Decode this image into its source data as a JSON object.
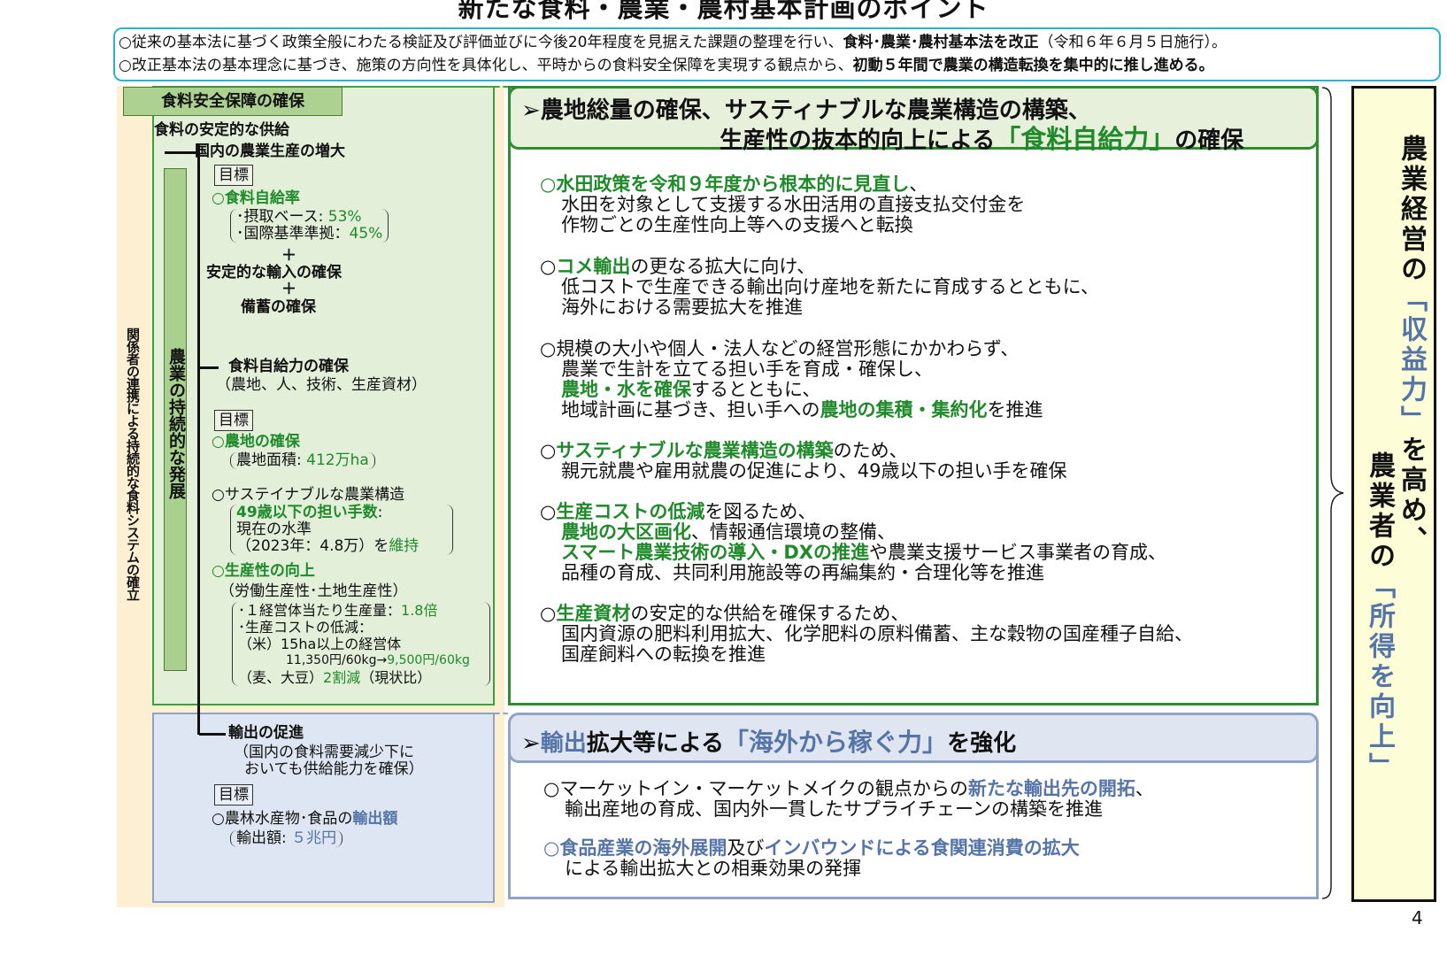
{
  "title": "新たな食料・農業・農村基本計画のポイント",
  "intro": {
    "line1_pre": "○従来の基本法に基づく政策全般にわたる検証及び評価並びに今後20年程度を見据えた課題の整理を行い、",
    "line1_bold": "食料･農業･農村基本法を改正",
    "line1_post": "（令和６年６月５日施行）。",
    "line2_pre": "○改正基本法の基本理念に基づき、施策の方向性を具体化し、平時からの食料安全保障を実現する観点から、",
    "line2_bold": "初動５年間で農業の構造転換を集中的に推し進める。"
  },
  "left": {
    "tag": "食料安全保障の確保",
    "vertical_outer": "関係者の連携による持続的な食料システムの確立",
    "vertical_stem": "農業の持続的な発展",
    "supply": "食料の安定的な供給",
    "domestic": "国内の農業生産の増大",
    "goal_label": "目標",
    "self_sufficiency": "○食料自給率",
    "ss_cal_label": "･摂取ベース: ",
    "ss_cal_value": "53%",
    "ss_intl_label": "･国際基準準拠：",
    "ss_intl_value": "45%",
    "plus": "＋",
    "import": "安定的な輸入の確保",
    "stock": "備蓄の確保",
    "capacity": "食料自給力の確保",
    "capacity_sub": "（農地、人、技術、生産資材）",
    "farmland": "○農地の確保",
    "farmland_area_label": "農地面積: ",
    "farmland_area_value": "412万ha",
    "sustainable": "○サステイナブルな農業構造",
    "young_label": "49歳以下の担い手数",
    "young_colon": ":",
    "young_line2": "現在の水準",
    "young_line3": "（2023年：4.8万）を",
    "young_keep": "維持",
    "productivity": "○生産性の向上",
    "productivity_sub": "（労働生産性･土地生産性）",
    "prod_line1_label": "･１経営体当たり生産量：",
    "prod_line1_value": "1.8倍",
    "prod_line2": "･生産コストの低減：",
    "prod_line3": "（米）15ha以上の経営体",
    "prod_line4_pre": "11,350円/60kg→",
    "prod_line4_value": "9,500円/60kg",
    "prod_line5_pre": "（麦、大豆）",
    "prod_line5_value": "2割減",
    "prod_line5_post": "（現状比）",
    "export": "輸出の促進",
    "export_sub1": "（国内の食料需要減少下に",
    "export_sub2": "おいても供給能力を確保）",
    "export_goal_pre": "○農林水産物･食品の",
    "export_goal_kw": "輸出額",
    "export_amount_label": "輸出額: ",
    "export_amount_value": "５兆円"
  },
  "right_green": {
    "heading1": "➢農地総量の確保、サスティナブルな農業構造の構築、",
    "heading2_pre": "生産性の抜本的向上による",
    "heading2_kw": "「食料自給力」",
    "heading2_post": "の確保",
    "items": [
      {
        "kw": "○水田政策を令和９年度から根本的に見直し",
        "rest": "、",
        "l2": "水田を対象として支援する水田活用の直接支払交付金を",
        "l3": "作物ごとの生産性向上等への支援へと転換"
      },
      {
        "pre": "○",
        "kw": "コメ輸出",
        "rest": "の更なる拡大に向け、",
        "l2": "低コストで生産できる輸出向け産地を新たに育成するとともに、",
        "l3": "海外における需要拡大を推進"
      },
      {
        "l1": "○規模の大小や個人・法人などの経営形態にかかわらず、",
        "l2": "農業で生計を立てる担い手を育成・確保し、",
        "l3_kw": "農地・水を確保",
        "l3_rest": "するとともに、",
        "l4_pre": "地域計画に基づき、担い手への",
        "l4_kw": "農地の集積・集約化",
        "l4_post": "を推進"
      },
      {
        "pre": "○",
        "kw": "サスティナブルな農業構造の構築",
        "rest": "のため、",
        "l2": "親元就農や雇用就農の促進により、49歳以下の担い手を確保"
      },
      {
        "pre": "○",
        "kw": "生産コストの低減",
        "rest": "を図るため、",
        "l2_kw": "農地の大区画化",
        "l2_rest": "、情報通信環境の整備、",
        "l3_kw": "スマート農業技術の導入・DXの推進",
        "l3_rest": "や農業支援サービス事業者の育成、",
        "l4": "品種の育成、共同利用施設等の再編集約・合理化等を推進"
      },
      {
        "pre": "○",
        "kw": "生産資材",
        "rest": "の安定的な供給を確保するため、",
        "l2": "国内資源の肥料利用拡大、化学肥料の原料備蓄、主な穀物の国産種子自給、",
        "l3": "国産飼料への転換を推進"
      }
    ]
  },
  "right_blue": {
    "heading_pre": "➢",
    "heading_kw1": "輸出",
    "heading_mid": "拡大等による",
    "heading_kw2": "「海外から稼ぐ力」",
    "heading_post": "を強化",
    "item1_pre": "○マーケットイン・マーケットメイクの観点からの",
    "item1_kw": "新たな輸出先の開拓",
    "item1_post": "、",
    "item1_l2": "輸出産地の育成、国内外一貫したサプライチェーンの構築を推進",
    "item2_kw1": "○食品産業の海外展開",
    "item2_mid": "及び",
    "item2_kw2": "インバウンドによる食関連消費の拡大",
    "item2_l2": "による輸出拡大との相乗効果の発揮"
  },
  "conclusion": {
    "col1_a": "農業経営の",
    "col1_kw": "「収益力」",
    "col1_b": "を高め、",
    "col2_a": "農業者の",
    "col2_kw": "「所得を向上」"
  },
  "page_number": "4",
  "colors": {
    "green_accent": "#1f8a2a",
    "blue_accent": "#5574a8",
    "intro_border": "#27b3d8"
  }
}
